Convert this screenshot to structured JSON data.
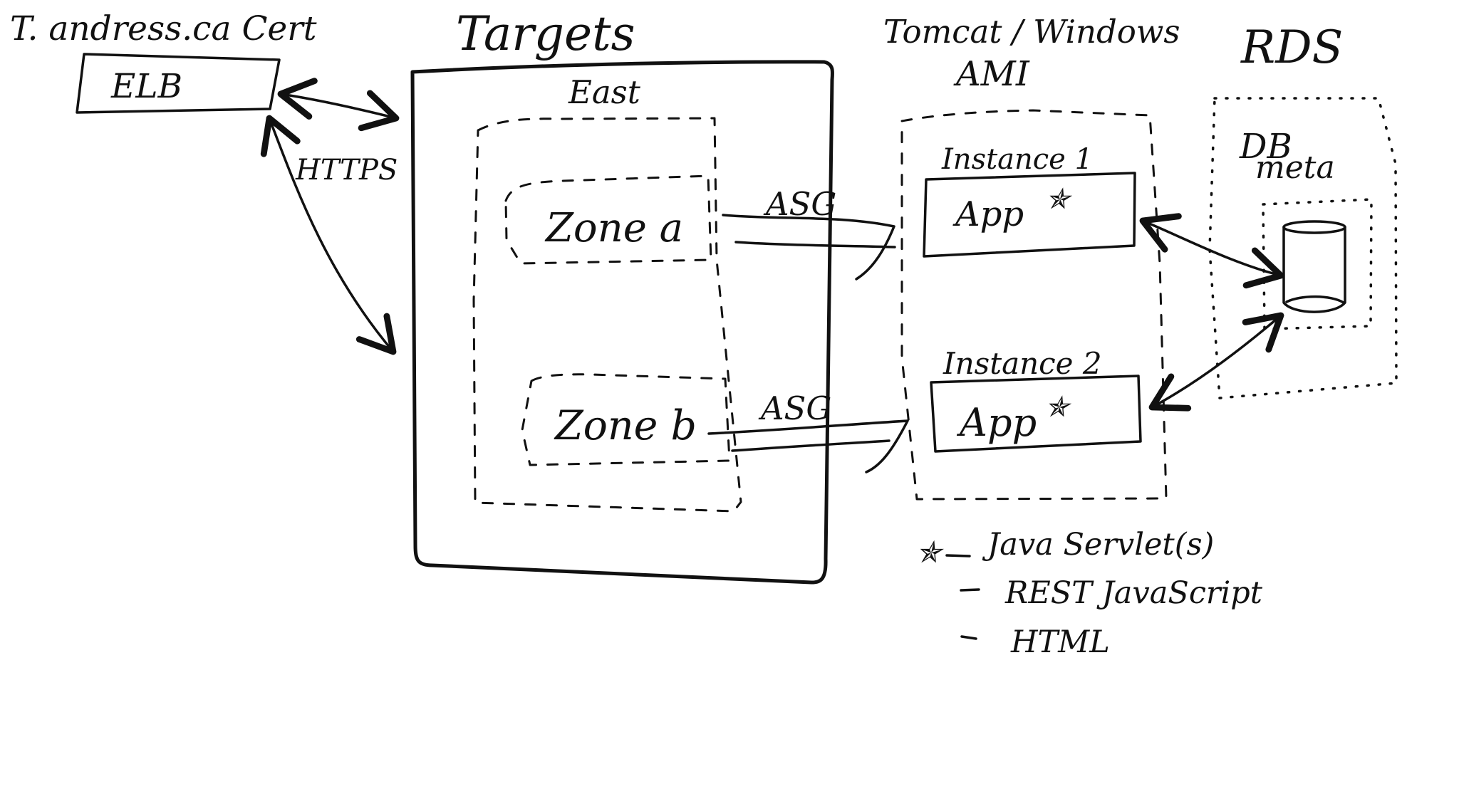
{
  "diagram": {
    "labels": {
      "cert": "T. andress.ca Cert",
      "elb": "ELB",
      "https": "HTTPS",
      "targets": "Targets",
      "east": "East",
      "zone_a": "Zone a",
      "zone_b": "Zone b",
      "asg_top": "ASG",
      "asg_bottom": "ASG",
      "tomcat_line1": "Tomcat / Windows",
      "tomcat_line2": "AMI",
      "rds": "RDS",
      "db_line1": "DB",
      "db_line2": "meta",
      "instance1": "Instance 1",
      "instance2": "Instance 2",
      "app1": "App",
      "app2": "App"
    },
    "legend": {
      "item1": "Java Servlet(s)",
      "item2": "REST JavaScript",
      "item3": "HTML"
    },
    "icons": {
      "star": "star-icon",
      "database": "database-cylinder-icon",
      "arrow": "arrow-icon"
    },
    "colors": {
      "ink": "#111111",
      "background": "#ffffff"
    }
  }
}
